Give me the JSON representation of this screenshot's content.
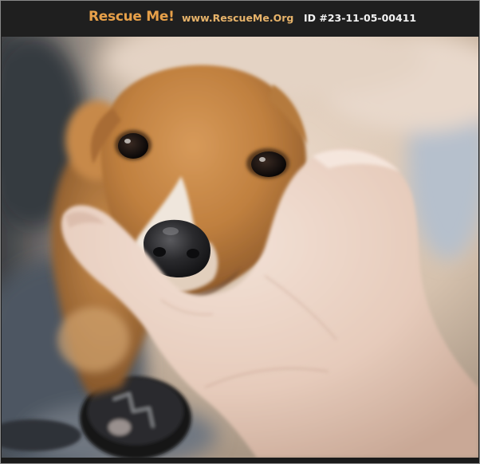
{
  "header": {
    "logo_text": "Rescue Me!",
    "site_url": "www.RescueMe.Org",
    "pet_id": "ID #23-11-05-00411"
  },
  "photo": {
    "subject": "dog-photo"
  },
  "colors": {
    "header_bg": "#1f1f1f",
    "logo": "#e7a049",
    "url": "#e7b36a",
    "id_text": "#f2f2f2"
  }
}
